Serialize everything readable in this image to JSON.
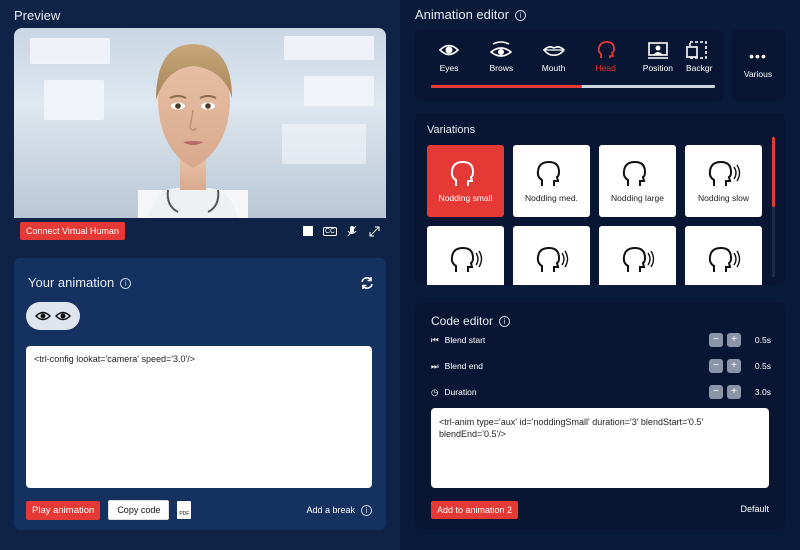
{
  "preview": {
    "title": "Preview",
    "connect_label": "Connect Virtual Human",
    "cc_label": "CC"
  },
  "your_animation": {
    "title": "Your animation",
    "code": "<trl-config lookat='camera' speed='3.0'/>",
    "play_label": "Play animation",
    "copy_label": "Copy code",
    "pdf_label": "PDF",
    "add_break_label": "Add a break"
  },
  "animation_editor": {
    "title": "Animation editor",
    "tabs": [
      {
        "label": "Eyes",
        "icon": "eye-icon"
      },
      {
        "label": "Brows",
        "icon": "brows-icon"
      },
      {
        "label": "Mouth",
        "icon": "mouth-icon"
      },
      {
        "label": "Head",
        "icon": "head-icon",
        "active": true
      },
      {
        "label": "Position",
        "icon": "position-icon"
      },
      {
        "label": "Backgr",
        "icon": "background-icon"
      }
    ],
    "progress": 0.53,
    "various_label": "Various"
  },
  "variations": {
    "title": "Variations",
    "items": [
      {
        "label": "Nodding small",
        "selected": true
      },
      {
        "label": "Nodding med."
      },
      {
        "label": "Nodding large"
      },
      {
        "label": "Nodding slow"
      },
      {
        "label": ""
      },
      {
        "label": ""
      },
      {
        "label": ""
      },
      {
        "label": ""
      }
    ]
  },
  "code_editor": {
    "title": "Code editor",
    "rows": [
      {
        "label": "Blend start",
        "value": "0.5s"
      },
      {
        "label": "Blend end",
        "value": "0.5s"
      },
      {
        "label": "Duration",
        "value": "3.0s"
      }
    ],
    "code": "<trl-anim type='aux' id='noddingSmall' duration='3' blendStart='0.5' blendEnd='0.5'/>",
    "add_label": "Add to animation 2",
    "default_label": "Default"
  },
  "colors": {
    "accent": "#e53935",
    "panel": "#143160",
    "dark_panel": "#081633"
  }
}
